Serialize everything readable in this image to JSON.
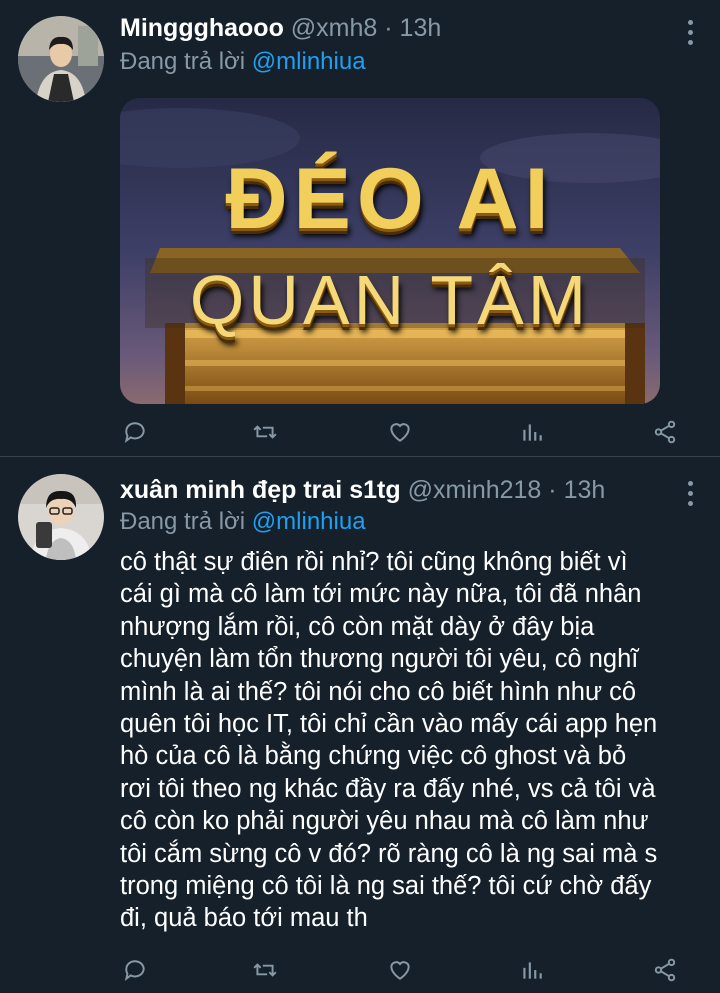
{
  "tweets": [
    {
      "name": "Minggghaooo",
      "handle": "@xmh8",
      "separator": "·",
      "time": "13h",
      "replying_prefix": "Đang trả lời",
      "replying_to": "@mlinhiua",
      "media": {
        "line1": "ĐÉO AI",
        "line2": "QUAN TÂM"
      },
      "actions": [
        "reply-icon",
        "retweet-icon",
        "like-icon",
        "analytics-icon",
        "share-icon"
      ]
    },
    {
      "name": "xuân minh đẹp trai s1tg",
      "handle": "@xminh218",
      "separator": "·",
      "time": "13h",
      "replying_prefix": "Đang trả lời",
      "replying_to": "@mlinhiua",
      "text": "cô thật sự điên rồi nhỉ? tôi cũng không biết vì\ncái gì mà cô làm tới mức này nữa, tôi đã nhân\nnhượng lắm rồi, cô còn mặt dày ở đây bịa\nchuyện làm tổn thương người tôi yêu, cô nghĩ\nmình là ai thế? tôi nói cho cô biết hình như cô\nquên tôi học IT, tôi chỉ cần vào mấy cái app hẹn\nhò của cô là bằng chứng việc cô ghost và bỏ\nrơi tôi theo ng khác đầy ra đấy nhé, vs cả tôi và\ncô còn ko phải người yêu nhau mà cô làm như\ntôi cắm sừng cô v đó? rõ ràng cô là ng sai mà s\ntrong miệng cô tôi là ng sai thế? tôi cứ chờ đấy\nđi, quả báo tới mau th",
      "actions": [
        "reply-icon",
        "retweet-icon",
        "like-icon",
        "analytics-icon",
        "share-icon"
      ]
    }
  ],
  "colors": {
    "background": "#15202b",
    "secondary_text": "#8899a6",
    "link": "#1da1f2",
    "divider": "#38444d"
  }
}
